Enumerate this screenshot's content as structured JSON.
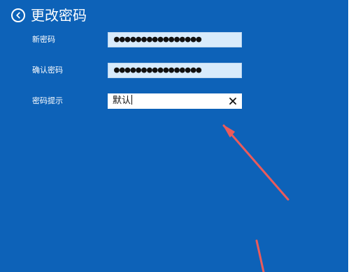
{
  "page": {
    "title": "更改密码"
  },
  "fields": {
    "new_password": {
      "label": "新密码",
      "value": "●●●●●●●●●●●●●●●●"
    },
    "confirm_password": {
      "label": "确认密码",
      "value": "●●●●●●●●●●●●●●●●"
    },
    "password_hint": {
      "label": "密码提示",
      "value": "默认"
    }
  },
  "colors": {
    "panel_background": "#0d62b8",
    "input_filled_background": "#d8ebfb",
    "arrow": "#ea5b5b",
    "text": "#ffffff"
  },
  "icons": {
    "back": "left-arrow-circle",
    "clear": "x",
    "annotation_arrow": "red-pointer-arrow"
  }
}
